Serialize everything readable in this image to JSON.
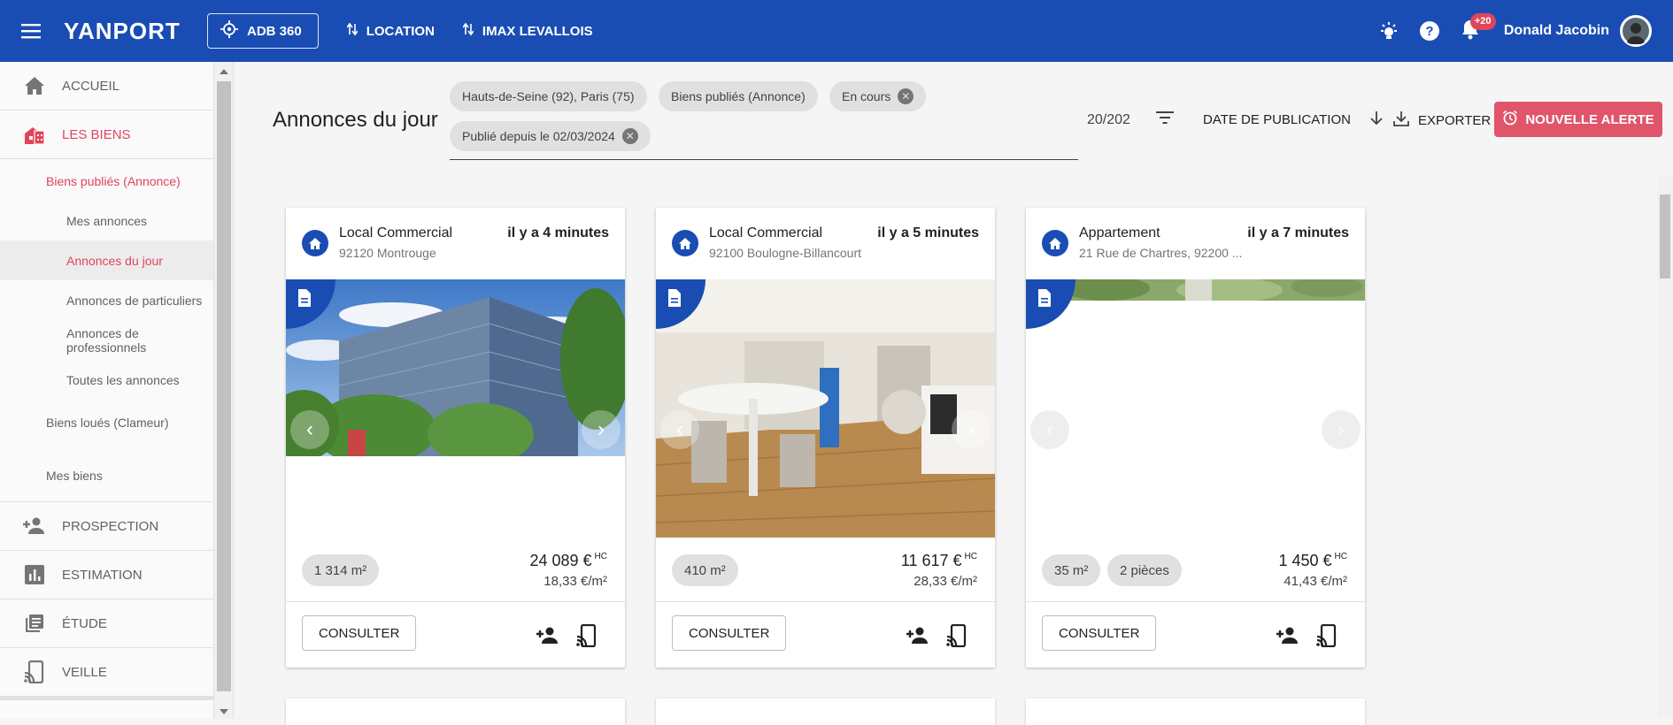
{
  "topbar": {
    "logo": "YANPORT",
    "agency": "ADB 360",
    "nav": [
      "LOCATION",
      "IMAX LEVALLOIS"
    ],
    "notif_count": "+20",
    "user_name": "Donald Jacobin"
  },
  "sidebar": {
    "sections": [
      {
        "label": "ACCUEIL",
        "icon": "home-icon"
      },
      {
        "label": "LES BIENS",
        "icon": "buildings-icon"
      },
      {
        "label": "PROSPECTION",
        "icon": "person-add-icon"
      },
      {
        "label": "ESTIMATION",
        "icon": "bar-chart-icon"
      },
      {
        "label": "ÉTUDE",
        "icon": "library-icon"
      },
      {
        "label": "VEILLE",
        "icon": "cast-icon"
      }
    ],
    "sub": {
      "biens_publies": "Biens publiés (Annonce)",
      "mes_annonces": "Mes annonces",
      "annonces_jour": "Annonces du jour",
      "annonces_particuliers": "Annonces de particuliers",
      "annonces_professionnels": "Annonces de professionnels",
      "toutes_annonces": "Toutes les annonces",
      "biens_loues": "Biens loués (Clameur)",
      "mes_biens": "Mes biens"
    }
  },
  "header": {
    "title": "Annonces du jour",
    "chips": [
      "Hauts-de-Seine (92), Paris (75)",
      "Biens publiés (Annonce)",
      "En cours",
      "Publié depuis le 02/03/2024"
    ],
    "counter": "20/202",
    "sort_label": "DATE DE PUBLICATION",
    "export_label": "EXPORTER",
    "alert_label": "NOUVELLE ALERTE"
  },
  "cards": [
    {
      "type": "Local Commercial",
      "location": "92120 Montrouge",
      "time": "il y a 4 minutes",
      "pills": [
        "1 314 m²"
      ],
      "price": "24 089 €",
      "price_suffix": "HC",
      "price_m2": "18,33 €/m²",
      "consult": "CONSULTER"
    },
    {
      "type": "Local Commercial",
      "location": "92100 Boulogne-Billancourt",
      "time": "il y a 5 minutes",
      "pills": [
        "410 m²"
      ],
      "price": "11 617 €",
      "price_suffix": "HC",
      "price_m2": "28,33 €/m²",
      "consult": "CONSULTER"
    },
    {
      "type": "Appartement",
      "location": "21 Rue de Chartres, 92200 ...",
      "time": "il y a 7 minutes",
      "pills": [
        "35 m²",
        "2 pièces"
      ],
      "price": "1 450 €",
      "price_suffix": "HC",
      "price_m2": "41,43 €/m²",
      "consult": "CONSULTER"
    }
  ],
  "colors": {
    "primary": "#1a4db3",
    "accent": "#e0455c"
  }
}
